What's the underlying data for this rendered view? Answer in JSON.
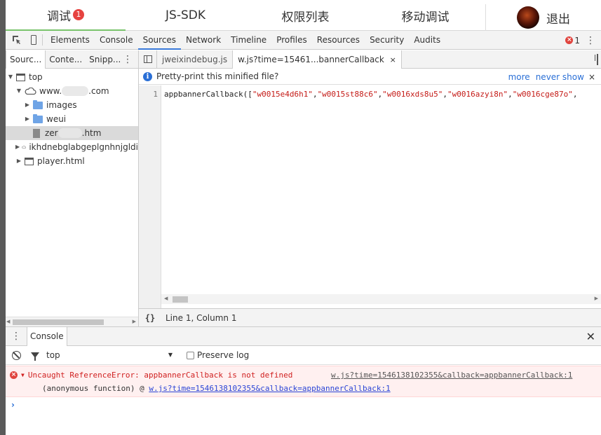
{
  "topbar": {
    "tabs": [
      {
        "label": "调试",
        "badge": "1"
      },
      {
        "label": "JS-SDK"
      },
      {
        "label": "权限列表"
      },
      {
        "label": "移动调试"
      }
    ],
    "exit_label": "退出"
  },
  "devtools": {
    "tabs": [
      "Elements",
      "Console",
      "Sources",
      "Network",
      "Timeline",
      "Profiles",
      "Resources",
      "Security",
      "Audits"
    ],
    "active_tab": "Sources",
    "error_count": "1"
  },
  "navigator": {
    "tabs": [
      "Sourc...",
      "Conte...",
      "Snipp..."
    ],
    "tree": [
      {
        "label": "top",
        "icon": "frame-icon"
      },
      {
        "label_prefix": "www.",
        "label_suffix": ".com",
        "icon": "cloud-icon"
      },
      {
        "label": "images",
        "icon": "folder-icon"
      },
      {
        "label": "weui",
        "icon": "folder-icon"
      },
      {
        "label_prefix": "zer",
        "label_suffix": ".htm",
        "icon": "file-icon"
      },
      {
        "label": "ikhdnebglabgeplgnhnjgldi",
        "icon": "cloud-icon"
      },
      {
        "label": "player.html",
        "icon": "frame-icon"
      }
    ]
  },
  "editor": {
    "tabs": [
      {
        "label": "jweixindebug.js"
      },
      {
        "label": "w.js?time=15461...bannerCallback",
        "close": "×"
      }
    ],
    "infobar": {
      "message": "Pretty-print this minified file?",
      "more": "more",
      "never_show": "never show",
      "close": "×"
    },
    "line_number": "1",
    "code_prefix": "appbannerCallback([",
    "code_strings": [
      "\"w0015e4d6h1\"",
      "\"w0015st88c6\"",
      "\"w0016xds8u5\"",
      "\"w0016azyi8n\"",
      "\"w0016cge87o\""
    ],
    "status_braces": "{}",
    "status_position": "Line 1, Column 1"
  },
  "console": {
    "tab_label": "Console",
    "context": "top",
    "preserve_log": "Preserve log",
    "error": {
      "message": "Uncaught ReferenceError: appbannerCallback is not defined",
      "source": "w.js?time=1546138102355&callback=appbannerCallback:1",
      "stack_fn": "(anonymous function)",
      "stack_at": "@",
      "stack_link": "w.js?time=1546138102355&callback=appbannerCallback:1"
    },
    "prompt": "›"
  }
}
